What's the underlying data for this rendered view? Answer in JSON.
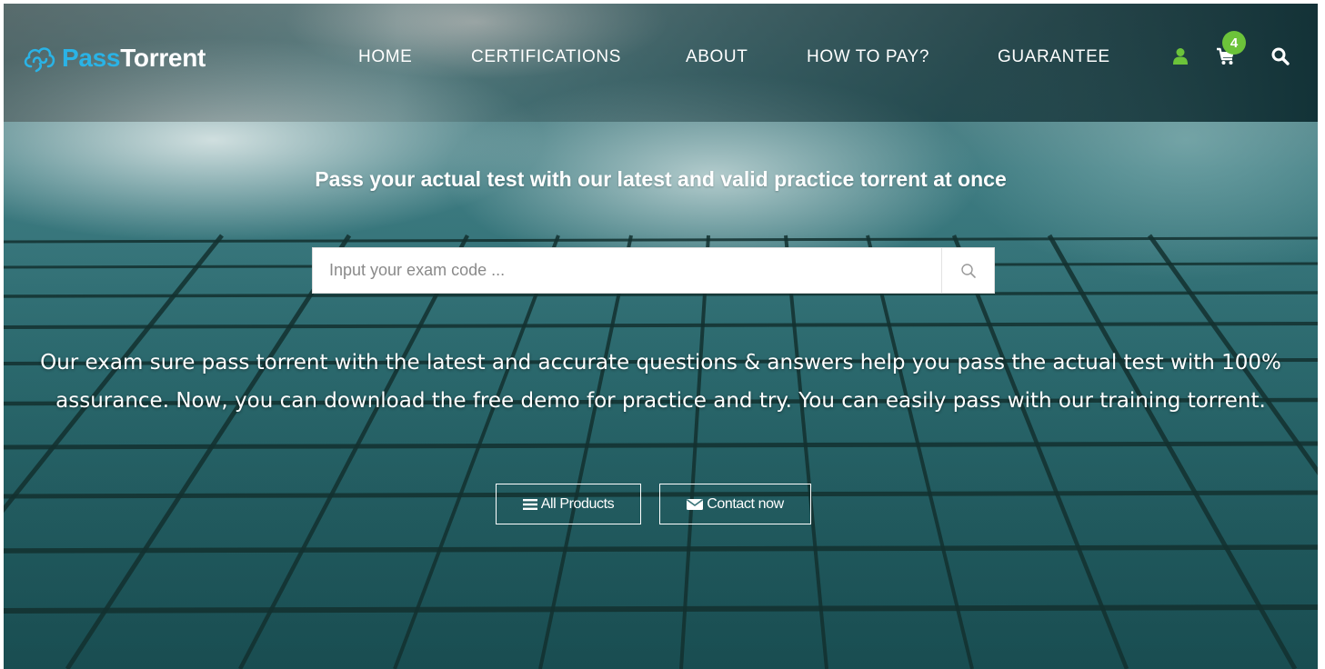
{
  "brand": {
    "name_part1": "Pass",
    "name_part2": "Torrent",
    "logo_icon": "cloud-swirl-icon",
    "accent_color": "#2ab3e6"
  },
  "nav": {
    "items": [
      {
        "label": "HOME"
      },
      {
        "label": "CERTIFICATIONS"
      },
      {
        "label": "ABOUT"
      },
      {
        "label": "HOW TO PAY?"
      },
      {
        "label": "GUARANTEE"
      }
    ],
    "tools": {
      "user_icon": "user-icon",
      "cart_icon": "cart-icon",
      "cart_count": "4",
      "search_icon": "search-icon",
      "icon_color": "#6cc33a"
    }
  },
  "hero": {
    "tagline": "Pass your actual test with our latest and valid practice torrent at once",
    "search": {
      "placeholder": "Input your exam code ...",
      "value": ""
    },
    "description": "Our exam sure pass torrent with the latest and accurate questions & answers help you pass the actual test with 100% assurance. Now, you can download the free demo for practice and try. You can easily pass with our training torrent.",
    "buttons": {
      "all_products": "All Products",
      "contact_now": "Contact now"
    }
  }
}
